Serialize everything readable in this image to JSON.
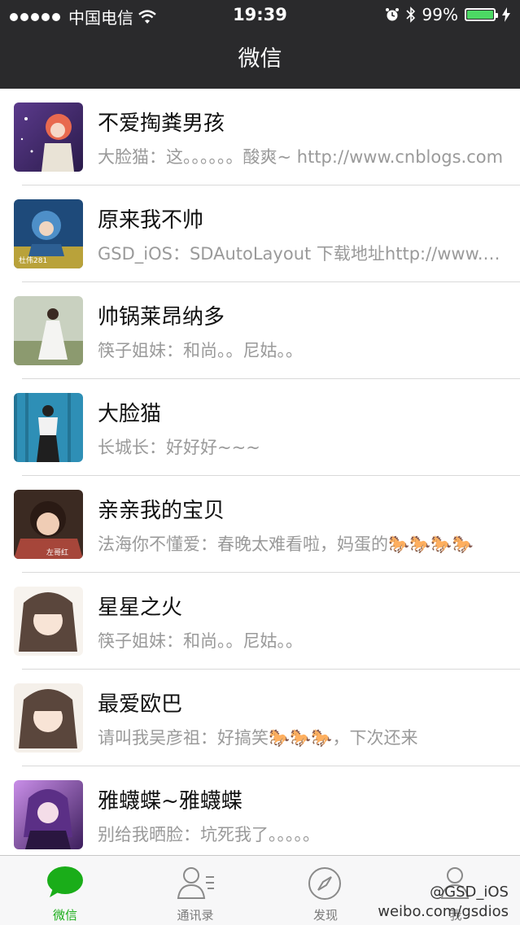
{
  "status_bar": {
    "carrier": "中国电信",
    "time": "19:39",
    "battery_percent": "99%",
    "battery_level": 0.99
  },
  "nav": {
    "title": "微信"
  },
  "chats": [
    {
      "name": "不爱掏粪男孩",
      "preview": "大脸猫：这。。。。。。酸爽~ http://www.cnblogs.com"
    },
    {
      "name": "原来我不帅",
      "preview": "GSD_iOS：SDAutoLayout  下载地址http://www.github.com"
    },
    {
      "name": "帅锅莱昂纳多",
      "preview": "筷子姐妹：和尚。。尼姑。。"
    },
    {
      "name": "大脸猫",
      "preview": "长城长：好好好~~~"
    },
    {
      "name": "亲亲我的宝贝",
      "preview": "法海你不懂爱：春晚太难看啦，妈蛋的🐎🐎🐎🐎"
    },
    {
      "name": "星星之火",
      "preview": "筷子姐妹：和尚。。尼姑。。"
    },
    {
      "name": "最爱欧巴",
      "preview": "请叫我吴彦祖：好搞笑🐎🐎🐎，下次还来"
    },
    {
      "name": "雅蠛蝶~雅蠛蝶",
      "preview": "别给我晒脸：坑死我了。。。。。"
    }
  ],
  "tabs": [
    {
      "label": "微信",
      "icon": "chat-bubble-icon"
    },
    {
      "label": "通讯录",
      "icon": "contacts-icon"
    },
    {
      "label": "发现",
      "icon": "compass-icon"
    },
    {
      "label": "我",
      "icon": "person-icon"
    }
  ],
  "watermark": {
    "line1": "@GSD_iOS",
    "line2": "weibo.com/gsdios"
  },
  "colors": {
    "nav_bg": "#2a2a2c",
    "accent": "#1aad19",
    "battery": "#4cd964"
  }
}
